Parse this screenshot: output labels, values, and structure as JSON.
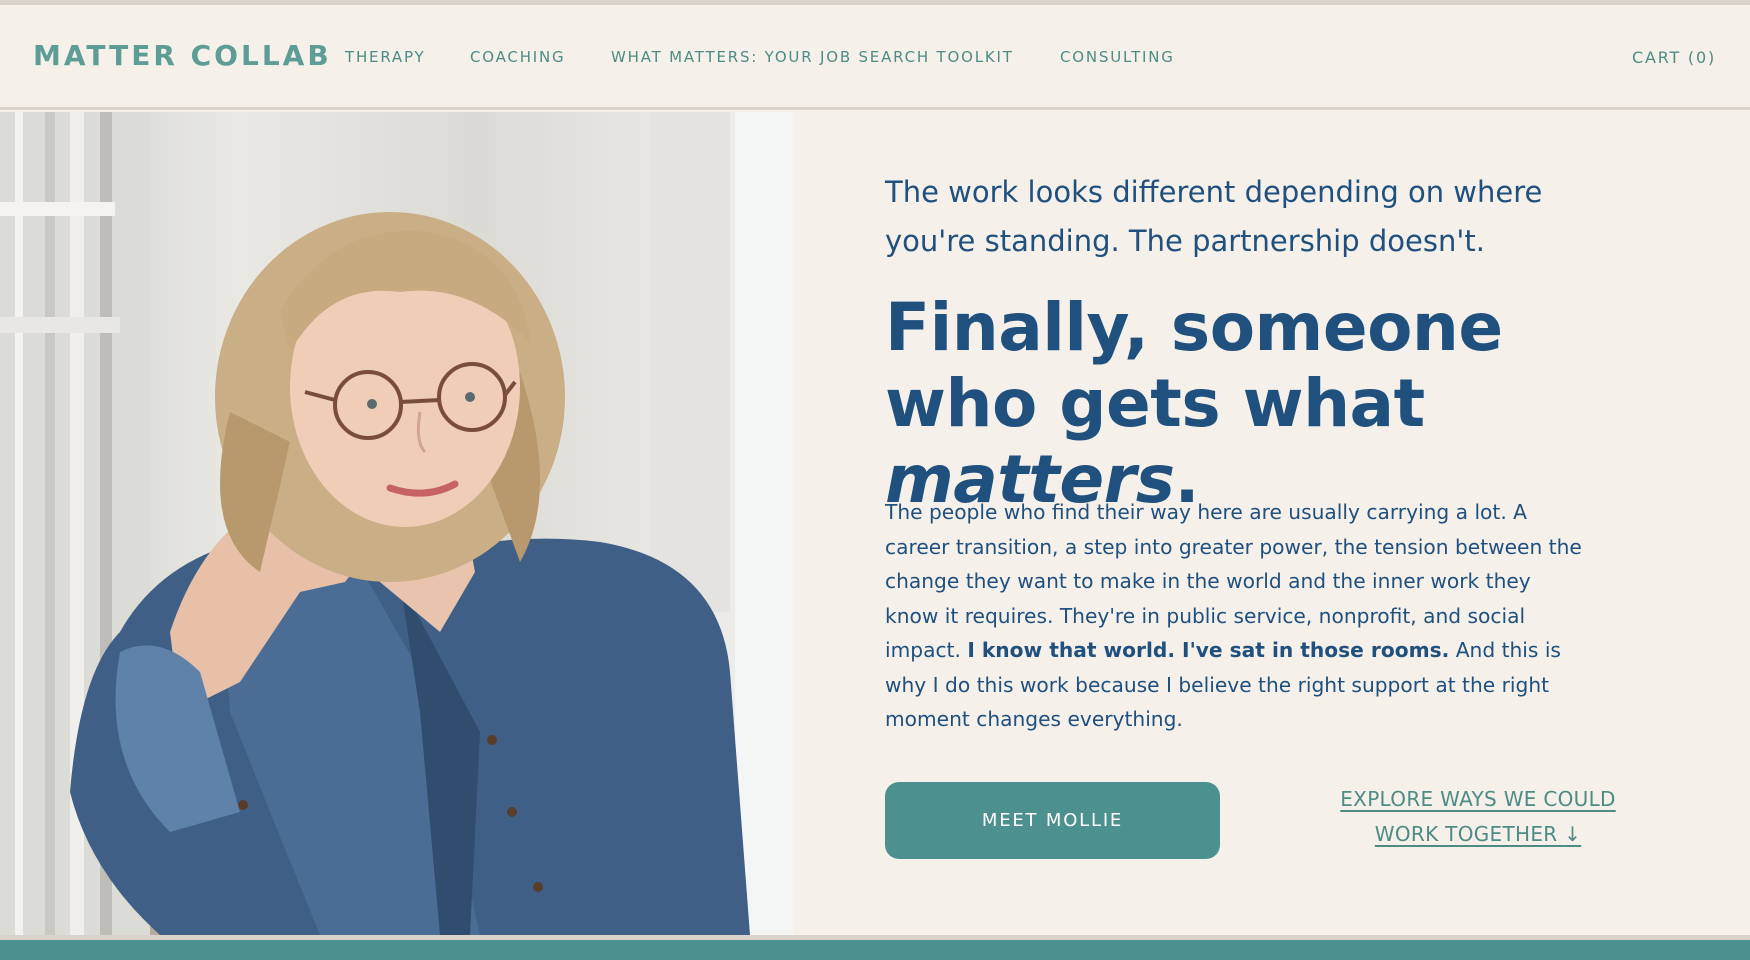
{
  "header": {
    "logo": "MATTER COLLAB",
    "nav": [
      {
        "label": "THERAPY"
      },
      {
        "label": "COACHING"
      },
      {
        "label": "WHAT MATTERS: YOUR JOB SEARCH TOOLKIT"
      },
      {
        "label": "CONSULTING"
      }
    ],
    "cart": "CART (0)"
  },
  "hero": {
    "kicker": "The work looks different depending on where you're standing. The partnership doesn't.",
    "headline_start": "Finally, someone who gets what ",
    "headline_em": "matters",
    "headline_end": ".",
    "body_part1": "The people who find their way here are usually carrying a lot. A career transition, a step into greater power, the tension between the change they want to make in the world and the inner work they know it requires. They're in public service, nonprofit, and social impact. ",
    "body_bold": "I know that world. I've sat in those rooms.",
    "body_part2": " And this is why I do this work because I believe the right support at the right moment changes everything.",
    "primary_button": "MEET MOLLIE",
    "secondary_link": "EXPLORE WAYS WE COULD WORK TOGETHER",
    "secondary_arrow": "↓"
  },
  "colors": {
    "background": "#f5f0ea",
    "teal": "#4c9190",
    "navy": "#20507e",
    "rule": "#d9d3cc"
  },
  "icons": {
    "secondary_link_arrow": "arrow-down-icon"
  }
}
